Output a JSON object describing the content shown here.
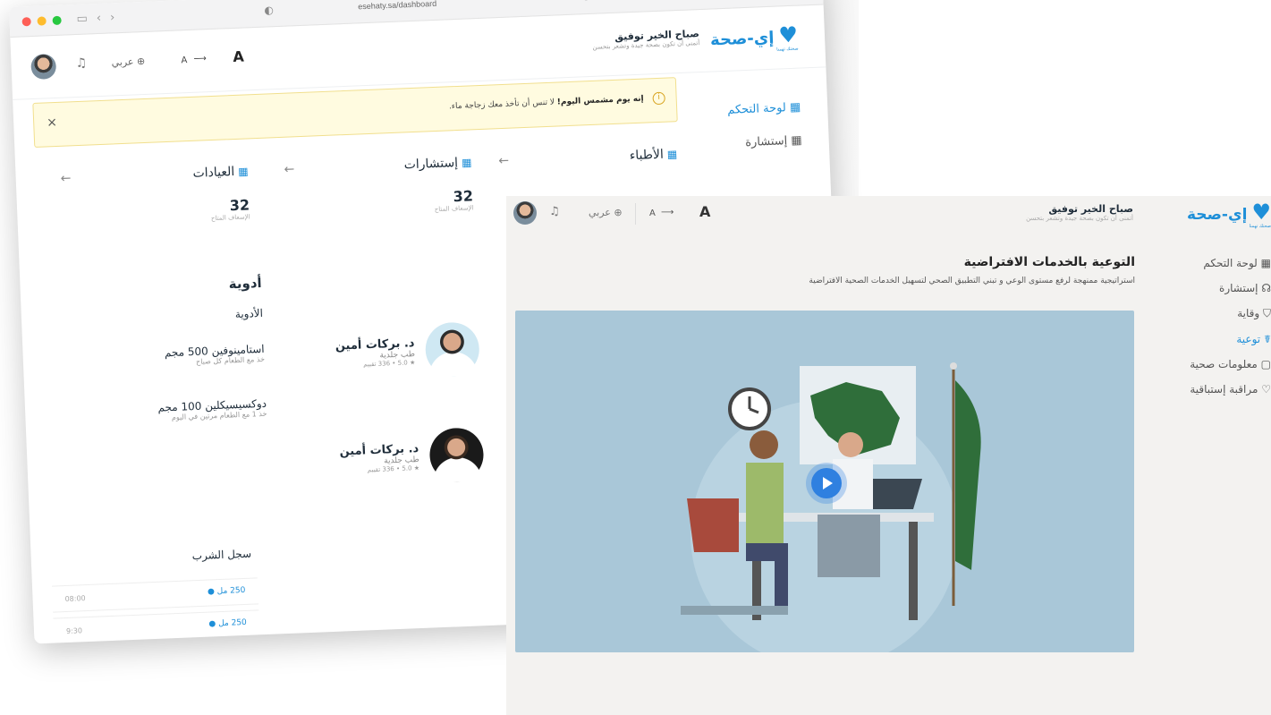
{
  "dashboard": {
    "browser": {
      "url": "esehaty.sa/dashboard"
    },
    "header": {
      "greeting": "صباح الخير توفيق",
      "subgreeting": "أتمنى أن تكون بصحة جيدة وتشعر بتحسن",
      "language": "عربي",
      "font_small": "A",
      "font_large": "A"
    },
    "logo": {
      "name": "إي-صحة",
      "tagline": "صحتك تهمنا"
    },
    "alert": {
      "close": "×",
      "bold": "إنه يوم مشمس اليوم!",
      "text": " لا تنس أن تأخذ معك زجاجة ماء."
    },
    "sidebar": [
      "لوحة التحكم",
      "إستشارة"
    ],
    "cards": [
      {
        "title": "العيادات",
        "value": "32",
        "caption": "الإسعاف المتاح"
      },
      {
        "title": "إستشارات",
        "value": "32",
        "caption": "الإسعاف المتاح"
      },
      {
        "title": "الأطباء"
      }
    ],
    "doctors": [
      {
        "name": "د. بركات أمين",
        "spec": "طب جلدية",
        "rating": "★ 5.0 • 336 تقييم"
      },
      {
        "name": "د. بركات أمين",
        "spec": "طب جلدية",
        "rating": "★ 5.0 • 336 تقييم"
      }
    ],
    "medicines": {
      "title": "أدوية",
      "subtitle": "الأدوية",
      "items": [
        {
          "name": "استامينوفين 500 مجم",
          "note": "خذ مع الطعام كل صباح"
        },
        {
          "name": "دوكسيسيكلين 100 مجم",
          "note": "خذ 1 مع الطعام مرتين في اليوم"
        }
      ]
    },
    "water": {
      "title": "سجل الشرب",
      "rows": [
        {
          "amount": "250 مل",
          "time": "08:00"
        },
        {
          "amount": "250 مل",
          "time": "9:30"
        }
      ]
    }
  },
  "awareness": {
    "header": {
      "greeting": "صباح الخير توفيق",
      "subgreeting": "أتمنى أن تكون بصحة جيدة وتشعر بتحسن",
      "language": "عربي",
      "font_small": "A",
      "font_large": "A"
    },
    "logo": {
      "name": "إي-صحة",
      "tagline": "صحتك تهمنا"
    },
    "title": "التوعية بالخدمات الافتراضية",
    "description": "استراتيجية ممنهجة لرفع مستوى الوعي و تبني التطبيق الصحي لتسهيل الخدمات الصحية الافتراضية",
    "sidebar": [
      "لوحة التحكم",
      "إستشارة",
      "وقاية",
      "توعية",
      "معلومات صحية",
      "مراقبة إستباقية"
    ],
    "active_index": 3
  },
  "colors": {
    "accent": "#1e8fd8",
    "alert_bg": "#fffbe0",
    "flag_green": "#2f6e3a"
  }
}
